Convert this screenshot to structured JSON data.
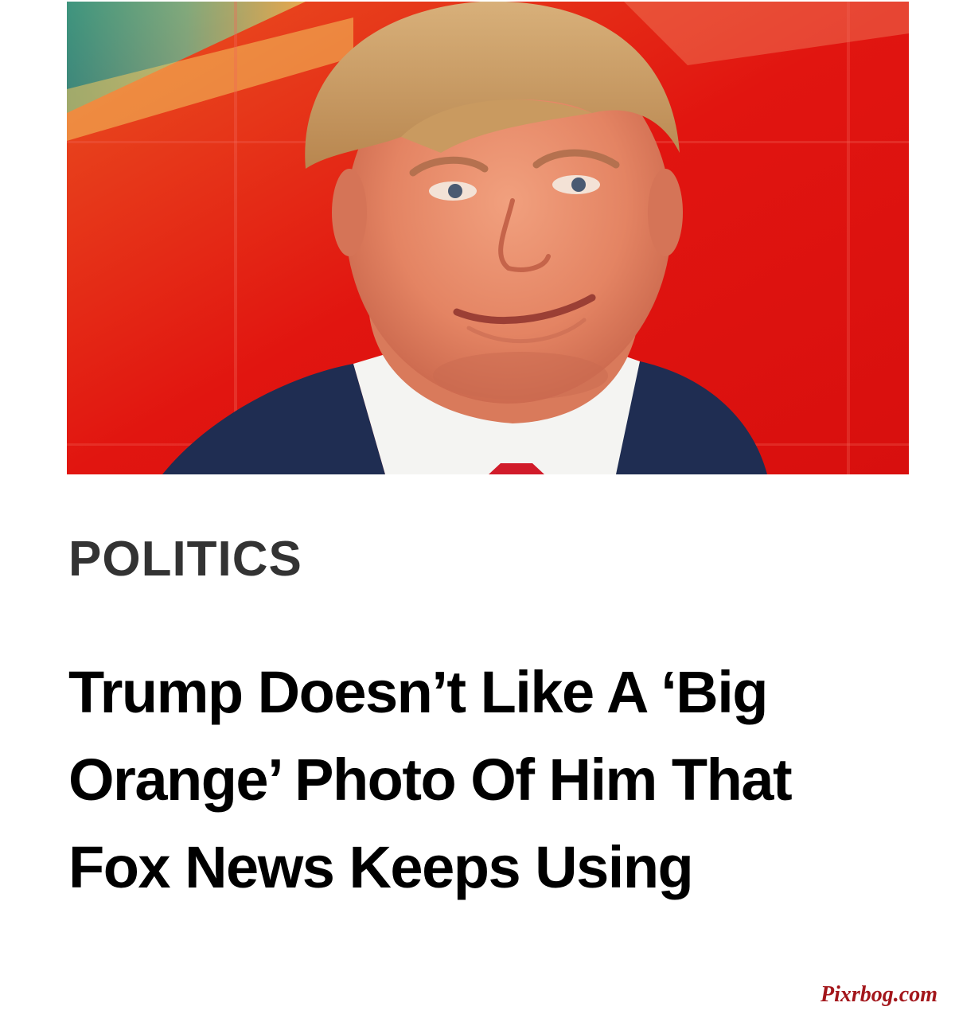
{
  "article": {
    "image": {
      "subject": "man-portrait-photo",
      "background_color": "#e11b14"
    },
    "category": "POLITICS",
    "headline": "Trump Doesn’t Like A ‘Big Orange’ Photo Of Him That Fox News Keeps Using"
  },
  "watermark": "Pixrbog.com",
  "colors": {
    "category_text": "#333333",
    "headline_text": "#000000",
    "watermark_text": "#a3161b"
  }
}
